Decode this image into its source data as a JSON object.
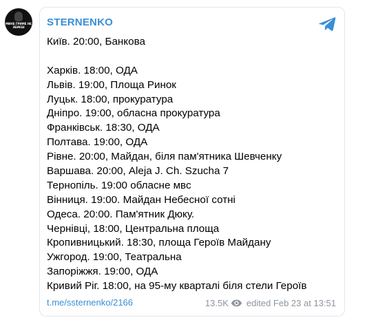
{
  "channel": {
    "name": "STERNENKO",
    "avatar_text": "МИНЕ ГРИМЕ НЕ ЗБИЄШ"
  },
  "message": {
    "lines": [
      "Київ. 20:00, Банкова",
      "",
      "Харків. 18:00, ОДА",
      "Львів. 19:00, Площа Ринок",
      "Луцьк. 18:00, прокуратура",
      "Дніпро. 19:00, обласна прокуратура",
      "Франківськ. 18:30, ОДА",
      "Полтава. 19:00, ОДА",
      "Рівне. 20:00, Майдан, біля пам'ятника Шевченку",
      "Варшава. 20:00, Aleja J. Ch. Szucha 7",
      "Тернопіль. 19:00 обласне мвс",
      "Вінниця. 19:00. Майдан Небесної сотні",
      "Одеса. 20:00. Пам'ятник Дюку.",
      "Чернівці, 18:00, Центральна площа",
      "Кропивницький. 18:30, площа Героїв Майдану",
      "Ужгород. 19:00, Театральна",
      "Запоріжжя. 19:00, ОДА",
      "Кривий Ріг. 18:00, на 95-му кварталі біля стели Героїв"
    ]
  },
  "footer": {
    "link": "t.me/ssternenko/2166",
    "views": "13.5K",
    "edited": "edited",
    "date": "Feb 23 at 13:51"
  },
  "icons": {
    "telegram": "telegram-icon",
    "views": "eye-icon"
  },
  "colors": {
    "accent": "#3a8fd6",
    "meta": "#8c95a0",
    "border": "#e3e6ea"
  }
}
